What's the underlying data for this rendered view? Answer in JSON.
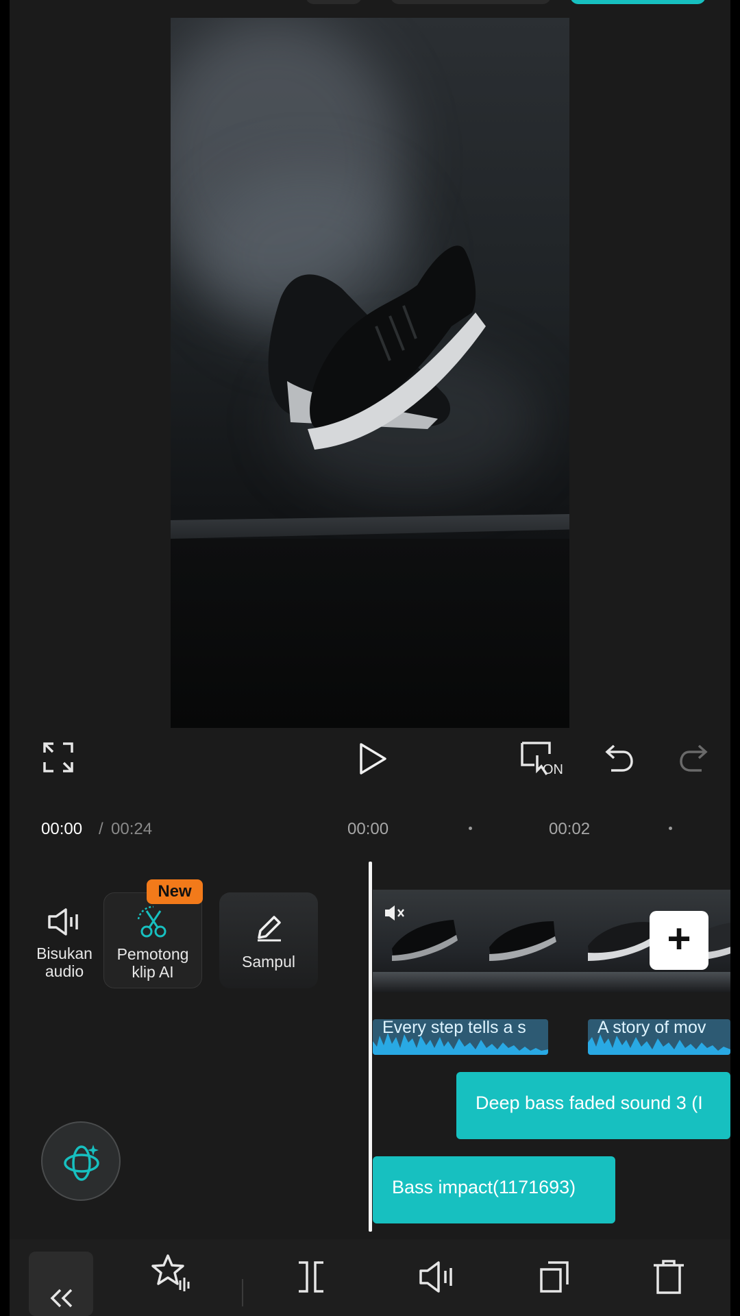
{
  "timecode": {
    "current": "00:00",
    "separator": "/",
    "total": "00:24"
  },
  "ruler": {
    "mark1": "00:00",
    "mark2": "00:02"
  },
  "tools": {
    "mute_audio": {
      "label_line1": "Bisukan",
      "label_line2": "audio"
    },
    "ai_clipper": {
      "label_line1": "Pemotong",
      "label_line2": "klip AI",
      "badge": "New"
    },
    "cover": {
      "label": "Sampul"
    }
  },
  "timeline": {
    "captions": [
      {
        "text": "Every step tells a s"
      },
      {
        "text": "A story of mov"
      }
    ],
    "audio": [
      {
        "text": "Deep bass faded sound 3 (I"
      },
      {
        "text": "Bass impact(1171693)"
      }
    ],
    "add_label": "+"
  },
  "playback": {
    "keyframe_label": "ON"
  },
  "colors": {
    "accent": "#17c0c0",
    "badge": "#f27a1a",
    "caption_wave": "#29a9e4"
  }
}
